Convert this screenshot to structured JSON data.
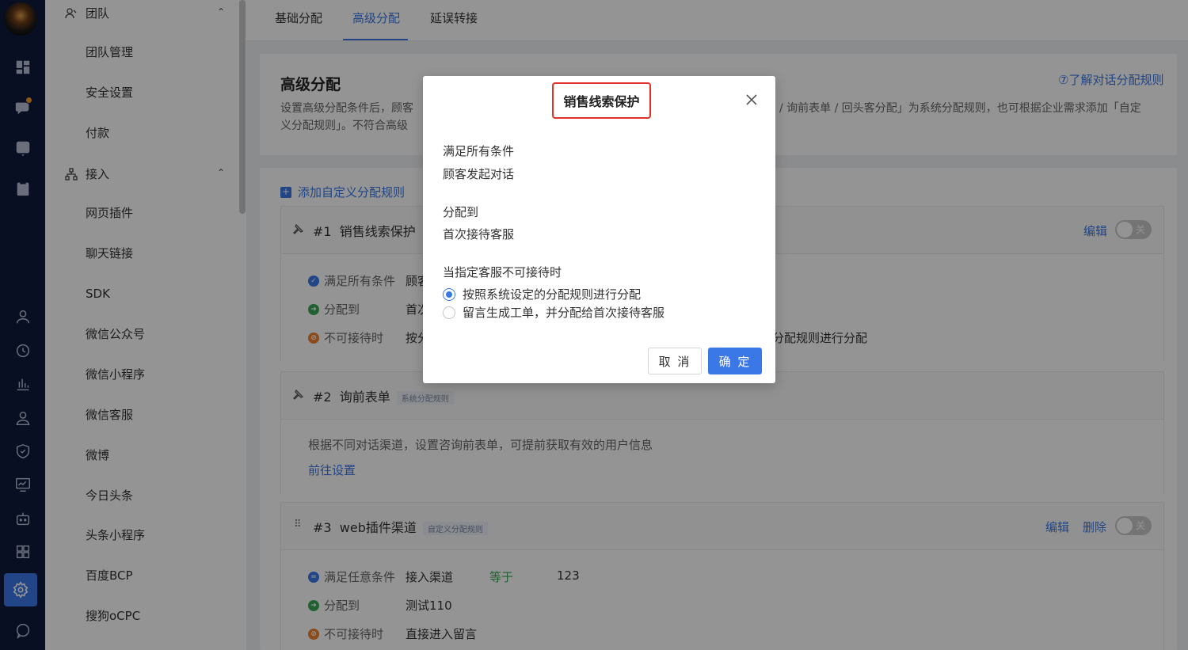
{
  "sidebar": {
    "groups": [
      {
        "label": "团队",
        "items": [
          "团队管理",
          "安全设置",
          "付款"
        ]
      },
      {
        "label": "接入",
        "items": [
          "网页插件",
          "聊天链接",
          "SDK",
          "微信公众号",
          "微信小程序",
          "微信客服",
          "微博",
          "今日头条",
          "头条小程序",
          "百度BCP",
          "搜狗oCPC"
        ]
      }
    ]
  },
  "tabs": [
    "基础分配",
    "高级分配",
    "延误转接"
  ],
  "main": {
    "title": "高级分配",
    "help_link": "⑦了解对话分配规则",
    "desc_left_1": "设置高级分配条件后，顾客",
    "desc_left_2": "义分配规则」。不符合高级",
    "desc_right": "/ 询前表单 / 回头客分配」为系统分配规则，也可根据企业需求添加「自定",
    "add_rule": "添加自定义分配规则",
    "rules": [
      {
        "num": "#1",
        "name": "销售线索保护",
        "edit": "编辑",
        "toggle": "关",
        "conds": [
          {
            "label": "满足所有条件",
            "value": "顾客"
          },
          {
            "label": "分配到",
            "value": "首次"
          },
          {
            "label": "不可接待时",
            "value": "按分",
            "value_right": "分配规则进行分配"
          }
        ]
      },
      {
        "num": "#2",
        "name": "询前表单",
        "tag": "系统分配规则",
        "body": "根据不同对话渠道，设置咨询前表单，可提前获取有效的用户信息",
        "link": "前往设置"
      },
      {
        "num": "#3",
        "name": "web插件渠道",
        "tag": "自定义分配规则",
        "edit": "编辑",
        "delete": "删除",
        "toggle": "关",
        "conds": [
          {
            "label": "满足任意条件",
            "value": "接入渠道",
            "op": "等于",
            "operand": "123"
          },
          {
            "label": "分配到",
            "value": "测试110"
          },
          {
            "label": "不可接待时",
            "value": "直接进入留言"
          }
        ]
      }
    ]
  },
  "modal": {
    "title": "销售线索保护",
    "sec1_label": "满足所有条件",
    "sec1_value": "顾客发起对话",
    "sec2_label": "分配到",
    "sec2_value": "首次接待客服",
    "sec3_label": "当指定客服不可接待时",
    "option1": "按照系统设定的分配规则进行分配",
    "option2": "留言生成工单，并分配给首次接待客服",
    "selected_option": 1,
    "cancel": "取 消",
    "ok": "确 定"
  },
  "colors": {
    "primary": "#3a78e8",
    "highlight_border": "#e0312b",
    "rail_bg": "#0f1a3c"
  }
}
